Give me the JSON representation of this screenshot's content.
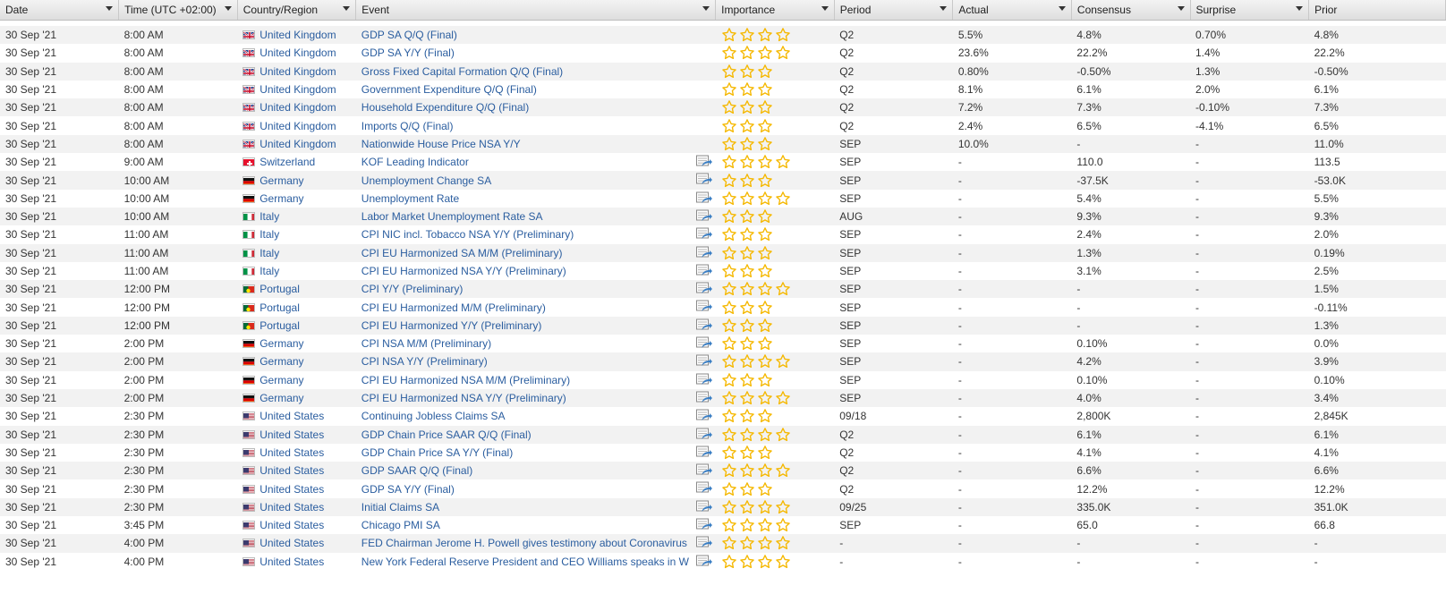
{
  "colors": {
    "link": "#2a5d9f",
    "star": "#f5b800",
    "row_alt": "#f2f2f2"
  },
  "headers": [
    "Date",
    "Time (UTC +02:00)",
    "Country/Region",
    "Event",
    "Importance",
    "Period",
    "Actual",
    "Consensus",
    "Surprise",
    "Prior"
  ],
  "rows": [
    {
      "date": "30 Sep '21",
      "time": "8:00 AM",
      "country": "United Kingdom",
      "flag": "gb",
      "event": "GDP SA Q/Q (Final)",
      "icon": false,
      "importance": 4,
      "period": "Q2",
      "actual": "5.5%",
      "consensus": "4.8%",
      "surprise": "0.70%",
      "prior": "4.8%"
    },
    {
      "date": "30 Sep '21",
      "time": "8:00 AM",
      "country": "United Kingdom",
      "flag": "gb",
      "event": "GDP SA Y/Y (Final)",
      "icon": false,
      "importance": 4,
      "period": "Q2",
      "actual": "23.6%",
      "consensus": "22.2%",
      "surprise": "1.4%",
      "prior": "22.2%"
    },
    {
      "date": "30 Sep '21",
      "time": "8:00 AM",
      "country": "United Kingdom",
      "flag": "gb",
      "event": "Gross Fixed Capital Formation Q/Q (Final)",
      "icon": false,
      "importance": 3,
      "period": "Q2",
      "actual": "0.80%",
      "consensus": "-0.50%",
      "surprise": "1.3%",
      "prior": "-0.50%"
    },
    {
      "date": "30 Sep '21",
      "time": "8:00 AM",
      "country": "United Kingdom",
      "flag": "gb",
      "event": "Government Expenditure Q/Q (Final)",
      "icon": false,
      "importance": 3,
      "period": "Q2",
      "actual": "8.1%",
      "consensus": "6.1%",
      "surprise": "2.0%",
      "prior": "6.1%"
    },
    {
      "date": "30 Sep '21",
      "time": "8:00 AM",
      "country": "United Kingdom",
      "flag": "gb",
      "event": "Household Expenditure Q/Q (Final)",
      "icon": false,
      "importance": 3,
      "period": "Q2",
      "actual": "7.2%",
      "consensus": "7.3%",
      "surprise": "-0.10%",
      "prior": "7.3%"
    },
    {
      "date": "30 Sep '21",
      "time": "8:00 AM",
      "country": "United Kingdom",
      "flag": "gb",
      "event": "Imports Q/Q (Final)",
      "icon": false,
      "importance": 3,
      "period": "Q2",
      "actual": "2.4%",
      "consensus": "6.5%",
      "surprise": "-4.1%",
      "prior": "6.5%"
    },
    {
      "date": "30 Sep '21",
      "time": "8:00 AM",
      "country": "United Kingdom",
      "flag": "gb",
      "event": "Nationwide House Price NSA Y/Y",
      "icon": false,
      "importance": 3,
      "period": "SEP",
      "actual": "10.0%",
      "consensus": "-",
      "surprise": "-",
      "prior": "11.0%"
    },
    {
      "date": "30 Sep '21",
      "time": "9:00 AM",
      "country": "Switzerland",
      "flag": "ch",
      "event": "KOF Leading Indicator",
      "icon": true,
      "importance": 4,
      "period": "SEP",
      "actual": "-",
      "consensus": "110.0",
      "surprise": "-",
      "prior": "113.5"
    },
    {
      "date": "30 Sep '21",
      "time": "10:00 AM",
      "country": "Germany",
      "flag": "de",
      "event": "Unemployment Change SA",
      "icon": true,
      "importance": 3,
      "period": "SEP",
      "actual": "-",
      "consensus": "-37.5K",
      "surprise": "-",
      "prior": "-53.0K"
    },
    {
      "date": "30 Sep '21",
      "time": "10:00 AM",
      "country": "Germany",
      "flag": "de",
      "event": "Unemployment Rate",
      "icon": true,
      "importance": 4,
      "period": "SEP",
      "actual": "-",
      "consensus": "5.4%",
      "surprise": "-",
      "prior": "5.5%"
    },
    {
      "date": "30 Sep '21",
      "time": "10:00 AM",
      "country": "Italy",
      "flag": "it",
      "event": "Labor Market Unemployment Rate SA",
      "icon": true,
      "importance": 3,
      "period": "AUG",
      "actual": "-",
      "consensus": "9.3%",
      "surprise": "-",
      "prior": "9.3%"
    },
    {
      "date": "30 Sep '21",
      "time": "11:00 AM",
      "country": "Italy",
      "flag": "it",
      "event": "CPI NIC incl. Tobacco NSA Y/Y (Preliminary)",
      "icon": true,
      "importance": 3,
      "period": "SEP",
      "actual": "-",
      "consensus": "2.4%",
      "surprise": "-",
      "prior": "2.0%"
    },
    {
      "date": "30 Sep '21",
      "time": "11:00 AM",
      "country": "Italy",
      "flag": "it",
      "event": "CPI EU Harmonized SA M/M (Preliminary)",
      "icon": true,
      "importance": 3,
      "period": "SEP",
      "actual": "-",
      "consensus": "1.3%",
      "surprise": "-",
      "prior": "0.19%"
    },
    {
      "date": "30 Sep '21",
      "time": "11:00 AM",
      "country": "Italy",
      "flag": "it",
      "event": "CPI EU Harmonized NSA Y/Y (Preliminary)",
      "icon": true,
      "importance": 3,
      "period": "SEP",
      "actual": "-",
      "consensus": "3.1%",
      "surprise": "-",
      "prior": "2.5%"
    },
    {
      "date": "30 Sep '21",
      "time": "12:00 PM",
      "country": "Portugal",
      "flag": "pt",
      "event": "CPI Y/Y (Preliminary)",
      "icon": true,
      "importance": 4,
      "period": "SEP",
      "actual": "-",
      "consensus": "-",
      "surprise": "-",
      "prior": "1.5%"
    },
    {
      "date": "30 Sep '21",
      "time": "12:00 PM",
      "country": "Portugal",
      "flag": "pt",
      "event": "CPI EU Harmonized M/M (Preliminary)",
      "icon": true,
      "importance": 3,
      "period": "SEP",
      "actual": "-",
      "consensus": "-",
      "surprise": "-",
      "prior": "-0.11%"
    },
    {
      "date": "30 Sep '21",
      "time": "12:00 PM",
      "country": "Portugal",
      "flag": "pt",
      "event": "CPI EU Harmonized Y/Y (Preliminary)",
      "icon": true,
      "importance": 3,
      "period": "SEP",
      "actual": "-",
      "consensus": "-",
      "surprise": "-",
      "prior": "1.3%"
    },
    {
      "date": "30 Sep '21",
      "time": "2:00 PM",
      "country": "Germany",
      "flag": "de",
      "event": "CPI NSA M/M (Preliminary)",
      "icon": true,
      "importance": 3,
      "period": "SEP",
      "actual": "-",
      "consensus": "0.10%",
      "surprise": "-",
      "prior": "0.0%"
    },
    {
      "date": "30 Sep '21",
      "time": "2:00 PM",
      "country": "Germany",
      "flag": "de",
      "event": "CPI NSA Y/Y (Preliminary)",
      "icon": true,
      "importance": 4,
      "period": "SEP",
      "actual": "-",
      "consensus": "4.2%",
      "surprise": "-",
      "prior": "3.9%"
    },
    {
      "date": "30 Sep '21",
      "time": "2:00 PM",
      "country": "Germany",
      "flag": "de",
      "event": "CPI EU Harmonized NSA M/M (Preliminary)",
      "icon": true,
      "importance": 3,
      "period": "SEP",
      "actual": "-",
      "consensus": "0.10%",
      "surprise": "-",
      "prior": "0.10%"
    },
    {
      "date": "30 Sep '21",
      "time": "2:00 PM",
      "country": "Germany",
      "flag": "de",
      "event": "CPI EU Harmonized NSA Y/Y (Preliminary)",
      "icon": true,
      "importance": 4,
      "period": "SEP",
      "actual": "-",
      "consensus": "4.0%",
      "surprise": "-",
      "prior": "3.4%"
    },
    {
      "date": "30 Sep '21",
      "time": "2:30 PM",
      "country": "United States",
      "flag": "us",
      "event": "Continuing Jobless Claims SA",
      "icon": true,
      "importance": 3,
      "period": "09/18",
      "actual": "-",
      "consensus": "2,800K",
      "surprise": "-",
      "prior": "2,845K"
    },
    {
      "date": "30 Sep '21",
      "time": "2:30 PM",
      "country": "United States",
      "flag": "us",
      "event": "GDP Chain Price SAAR Q/Q (Final)",
      "icon": true,
      "importance": 4,
      "period": "Q2",
      "actual": "-",
      "consensus": "6.1%",
      "surprise": "-",
      "prior": "6.1%"
    },
    {
      "date": "30 Sep '21",
      "time": "2:30 PM",
      "country": "United States",
      "flag": "us",
      "event": "GDP Chain Price SA Y/Y (Final)",
      "icon": true,
      "importance": 3,
      "period": "Q2",
      "actual": "-",
      "consensus": "4.1%",
      "surprise": "-",
      "prior": "4.1%"
    },
    {
      "date": "30 Sep '21",
      "time": "2:30 PM",
      "country": "United States",
      "flag": "us",
      "event": "GDP SAAR Q/Q (Final)",
      "icon": true,
      "importance": 4,
      "period": "Q2",
      "actual": "-",
      "consensus": "6.6%",
      "surprise": "-",
      "prior": "6.6%"
    },
    {
      "date": "30 Sep '21",
      "time": "2:30 PM",
      "country": "United States",
      "flag": "us",
      "event": "GDP SA Y/Y (Final)",
      "icon": true,
      "importance": 3,
      "period": "Q2",
      "actual": "-",
      "consensus": "12.2%",
      "surprise": "-",
      "prior": "12.2%"
    },
    {
      "date": "30 Sep '21",
      "time": "2:30 PM",
      "country": "United States",
      "flag": "us",
      "event": "Initial Claims SA",
      "icon": true,
      "importance": 4,
      "period": "09/25",
      "actual": "-",
      "consensus": "335.0K",
      "surprise": "-",
      "prior": "351.0K"
    },
    {
      "date": "30 Sep '21",
      "time": "3:45 PM",
      "country": "United States",
      "flag": "us",
      "event": "Chicago PMI SA",
      "icon": true,
      "importance": 4,
      "period": "SEP",
      "actual": "-",
      "consensus": "65.0",
      "surprise": "-",
      "prior": "66.8"
    },
    {
      "date": "30 Sep '21",
      "time": "4:00 PM",
      "country": "United States",
      "flag": "us",
      "event": "FED Chairman Jerome H. Powell gives testimony about Coronavirus",
      "icon": true,
      "importance": 4,
      "period": "-",
      "actual": "-",
      "consensus": "-",
      "surprise": "-",
      "prior": "-"
    },
    {
      "date": "30 Sep '21",
      "time": "4:00 PM",
      "country": "United States",
      "flag": "us",
      "event": "New York Federal Reserve President and CEO Williams speaks in W",
      "icon": true,
      "importance": 4,
      "period": "-",
      "actual": "-",
      "consensus": "-",
      "surprise": "-",
      "prior": "-"
    }
  ]
}
